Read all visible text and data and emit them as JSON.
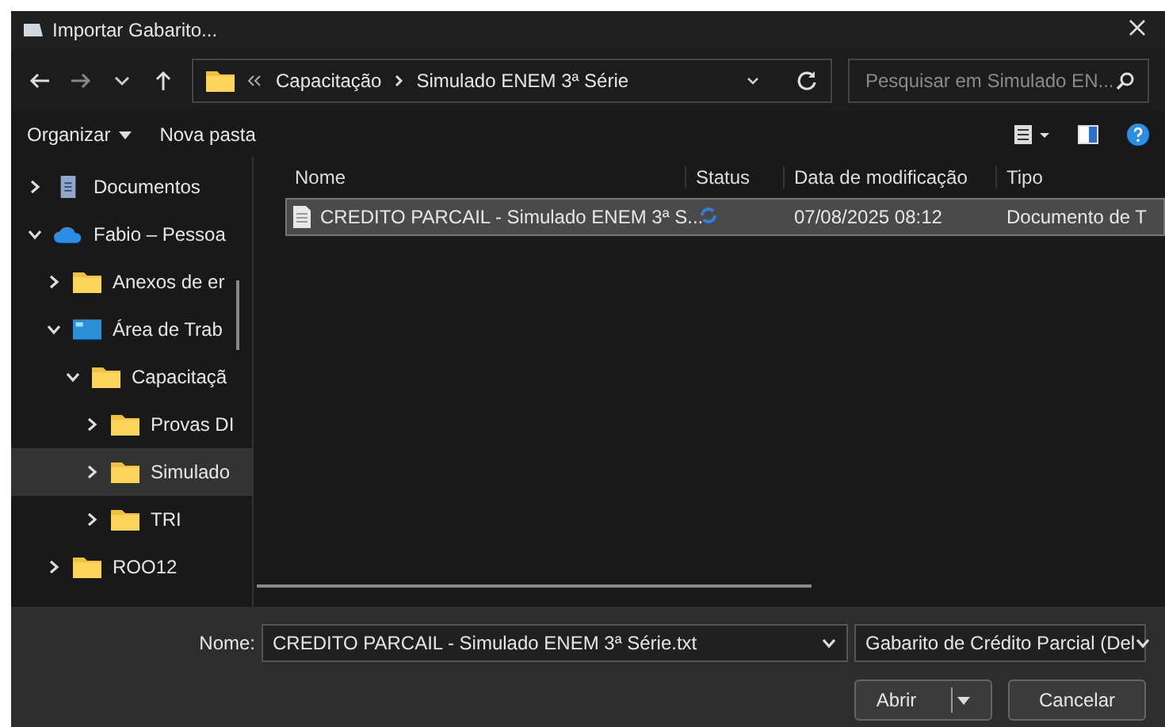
{
  "window": {
    "title": "Importar Gabarito..."
  },
  "address_bar": {
    "segments": [
      "Capacitação",
      "Simulado ENEM 3ª Série"
    ]
  },
  "search": {
    "placeholder": "Pesquisar em Simulado EN..."
  },
  "toolbar": {
    "organize": "Organizar",
    "new_folder": "Nova pasta"
  },
  "sidebar": {
    "items": [
      {
        "label": "Documentos",
        "kind": "documents",
        "expanded": false,
        "selected": false
      },
      {
        "label": "Fabio – Pessoa",
        "kind": "cloud",
        "expanded": true,
        "selected": false,
        "children": [
          {
            "label": "Anexos de er",
            "kind": "folder",
            "expanded": false,
            "selected": false
          },
          {
            "label": "Área de Trab",
            "kind": "desktop",
            "expanded": true,
            "selected": false,
            "children": [
              {
                "label": "Capacitaçã",
                "kind": "folder",
                "expanded": true,
                "selected": false,
                "children": [
                  {
                    "label": "Provas DI",
                    "kind": "folder",
                    "expanded": false,
                    "selected": false
                  },
                  {
                    "label": "Simulado",
                    "kind": "folder",
                    "expanded": false,
                    "selected": true
                  },
                  {
                    "label": "TRI",
                    "kind": "folder",
                    "expanded": false,
                    "selected": false
                  }
                ]
              }
            ]
          },
          {
            "label": "ROO12",
            "kind": "folder",
            "expanded": false,
            "selected": false
          }
        ]
      }
    ]
  },
  "table": {
    "columns": [
      "Nome",
      "Status",
      "Data de modificação",
      "Tipo"
    ],
    "rows": [
      {
        "name": "CREDITO PARCAIL - Simulado ENEM 3ª S...",
        "date": "07/08/2025 08:12",
        "type": "Documento de T",
        "selected": true
      }
    ]
  },
  "footer": {
    "name_label": "Nome:",
    "file_name": "CREDITO PARCAIL - Simulado ENEM 3ª Série.txt",
    "filter": "Gabarito de Crédito Parcial (Del",
    "open": "Abrir",
    "cancel": "Cancelar"
  }
}
